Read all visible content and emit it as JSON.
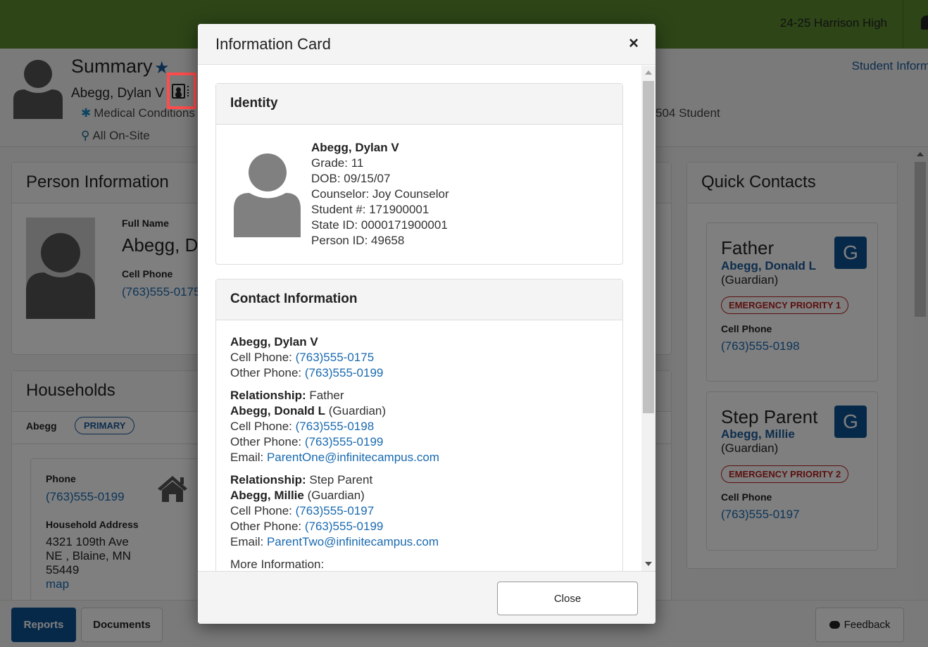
{
  "topbar": {
    "school_year": "24-25 Harrison High",
    "colors": {
      "bar": "#5a8a2e"
    }
  },
  "summary": {
    "title": "Summary",
    "student_name": "Abegg, Dylan V",
    "flags": [
      {
        "icon": "medical-asterisk-icon",
        "label": "Medical Conditions"
      },
      {
        "icon": "on-site-person-icon",
        "label": "All On-Site"
      },
      {
        "label": "504 Student"
      }
    ],
    "student_info_link": "Student Information"
  },
  "person_panel": {
    "title": "Person Information",
    "full_name_label": "Full Name",
    "full_name": "Abegg, Dylan V",
    "cell_phone_label": "Cell Phone",
    "cell_phone": "(763)555-0175"
  },
  "households_panel": {
    "title": "Households",
    "household_name": "Abegg",
    "household_badge": "PRIMARY",
    "phone_label": "Phone",
    "phone": "(763)555-0199",
    "address_label": "Household Address",
    "address_line1": "4321 109th Ave",
    "address_line2": "NE , Blaine, MN",
    "address_line3": "55449",
    "map_link": "map"
  },
  "quick_contacts": {
    "title": "Quick Contacts",
    "contacts": [
      {
        "relationship": "Father",
        "name": "Abegg, Donald L",
        "role": "(Guardian)",
        "badge": "G",
        "priority": "EMERGENCY PRIORITY 1",
        "phone_label": "Cell Phone",
        "phone": "(763)555-0198"
      },
      {
        "relationship": "Step Parent",
        "name": "Abegg, Millie",
        "role": "(Guardian)",
        "badge": "G",
        "priority": "EMERGENCY PRIORITY 2",
        "phone_label": "Cell Phone",
        "phone": "(763)555-0197"
      }
    ]
  },
  "footer": {
    "reports": "Reports",
    "documents": "Documents",
    "feedback": "Feedback"
  },
  "modal": {
    "title": "Information Card",
    "close_x": "×",
    "identity": {
      "heading": "Identity",
      "name": "Abegg, Dylan V",
      "grade": "Grade: 11",
      "dob": "DOB: 09/15/07",
      "counselor": "Counselor: Joy Counselor",
      "student_number": "Student #: 171900001",
      "state_id": "State ID: 0000171900001",
      "person_id": "Person ID: 49658"
    },
    "contact": {
      "heading": "Contact Information",
      "student": {
        "name": "Abegg, Dylan V",
        "cell_label": "Cell Phone: ",
        "cell": "(763)555-0175",
        "other_label": "Other Phone: ",
        "other": "(763)555-0199"
      },
      "guardians": [
        {
          "rel_label": "Relationship:",
          "relationship": " Father",
          "name": "Abegg, Donald L",
          "role": " (Guardian)",
          "cell_label": "Cell Phone: ",
          "cell": "(763)555-0198",
          "other_label": "Other Phone: ",
          "other": "(763)555-0199",
          "email_label": "Email: ",
          "email": "ParentOne@infinitecampus.com"
        },
        {
          "rel_label": "Relationship:",
          "relationship": " Step Parent",
          "name": "Abegg, Millie",
          "role": " (Guardian)",
          "cell_label": "Cell Phone: ",
          "cell": "(763)555-0197",
          "other_label": "Other Phone: ",
          "other": "(763)555-0199",
          "email_label": "Email: ",
          "email": "ParentTwo@infinitecampus.com"
        }
      ],
      "more_info": "More Information:"
    },
    "close_button": "Close"
  }
}
